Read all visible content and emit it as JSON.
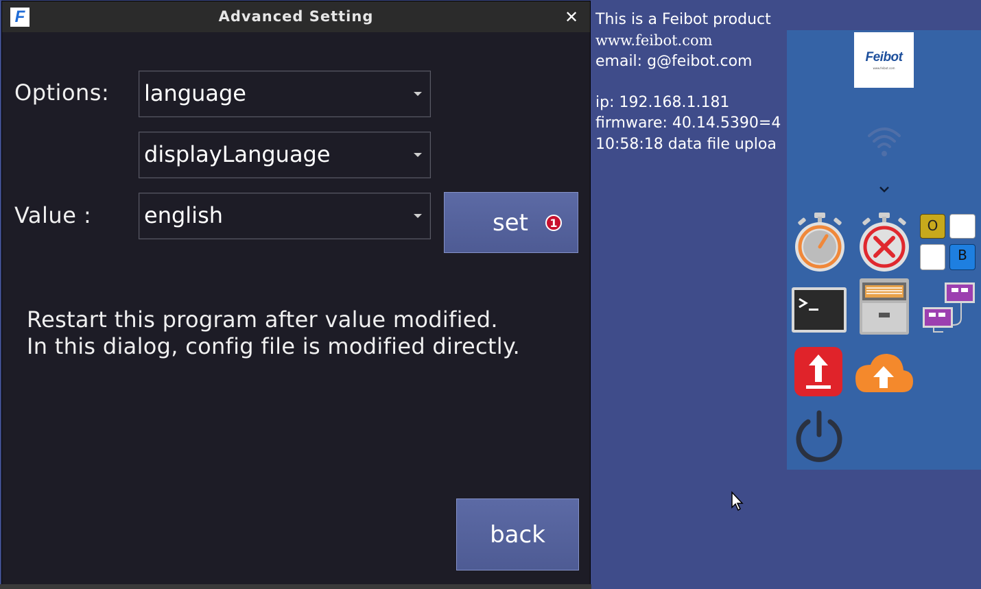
{
  "desktop": {
    "info_lines": [
      "This is a Feibot product",
      "www.feibot.com",
      "email: g@feibot.com",
      "",
      "ip: 192.168.1.181",
      "firmware: 40.14.5390=4",
      "10:58:18 data file uploa"
    ],
    "dock": {
      "logo_text": "Feibot",
      "logo_subtext": "www.feibot.com",
      "grid_labels": [
        "O",
        "B"
      ],
      "icons": [
        "wifi-icon",
        "chevron-down-icon",
        "stopwatch-icon",
        "stopwatch-cancel-icon",
        "color-grid-icon",
        "terminal-icon",
        "file-cabinet-icon",
        "network-computers-icon",
        "upload-red-icon",
        "cloud-upload-icon",
        "power-icon"
      ]
    }
  },
  "dialog": {
    "title": "Advanced Setting",
    "close_glyph": "✕",
    "app_icon_letter": "F",
    "options_label": "Options:",
    "option_select_1": "language",
    "option_select_2": "displayLanguage",
    "value_label": "Value :",
    "value_select": "english",
    "set_button": "set",
    "set_badge": "1",
    "note_line_1": "Restart this program after value modified.",
    "note_line_2": "In this dialog, config file is modified directly.",
    "back_button": "back"
  },
  "colors": {
    "desktop_bg": "#3f4c8a",
    "dock_bg": "#3563a6",
    "dialog_bg": "#1d1c26",
    "button": "#56639c",
    "badge": "#c8102e"
  }
}
